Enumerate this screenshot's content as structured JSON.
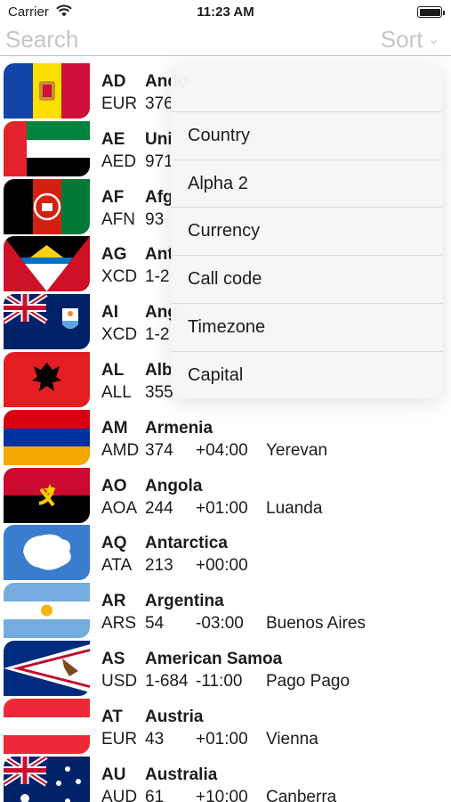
{
  "status_bar": {
    "carrier": "Carrier",
    "time": "11:23 AM"
  },
  "search": {
    "placeholder": "Search"
  },
  "sort": {
    "label": "Sort",
    "icon": "chevron-down-icon"
  },
  "sort_menu": {
    "items": [
      "Country",
      "Alpha 2",
      "Currency",
      "Call code",
      "Timezone",
      "Capital"
    ]
  },
  "countries": [
    {
      "code": "AD",
      "name": "Ando",
      "currency": "EUR",
      "call": "376",
      "tz": "",
      "capital": ""
    },
    {
      "code": "AE",
      "name": "Uni",
      "currency": "AED",
      "call": "971",
      "tz": "",
      "capital": ""
    },
    {
      "code": "AF",
      "name": "Afg",
      "currency": "AFN",
      "call": "93",
      "tz": "",
      "capital": ""
    },
    {
      "code": "AG",
      "name": "Ant",
      "currency": "XCD",
      "call": "1-2",
      "tz": "",
      "capital": ""
    },
    {
      "code": "AI",
      "name": "Ang",
      "currency": "XCD",
      "call": "1-2",
      "tz": "",
      "capital": ""
    },
    {
      "code": "AL",
      "name": "Alb",
      "currency": "ALL",
      "call": "355",
      "tz": "",
      "capital": ""
    },
    {
      "code": "AM",
      "name": "Armenia",
      "currency": "AMD",
      "call": "374",
      "tz": "+04:00",
      "capital": "Yerevan"
    },
    {
      "code": "AO",
      "name": "Angola",
      "currency": "AOA",
      "call": "244",
      "tz": "+01:00",
      "capital": "Luanda"
    },
    {
      "code": "AQ",
      "name": "Antarctica",
      "currency": "ATA",
      "call": "213",
      "tz": "+00:00",
      "capital": ""
    },
    {
      "code": "AR",
      "name": "Argentina",
      "currency": "ARS",
      "call": "54",
      "tz": "-03:00",
      "capital": "Buenos Aires"
    },
    {
      "code": "AS",
      "name": "American Samoa",
      "currency": "USD",
      "call": "1-684",
      "tz": "-11:00",
      "capital": "Pago Pago"
    },
    {
      "code": "AT",
      "name": "Austria",
      "currency": "EUR",
      "call": "43",
      "tz": "+01:00",
      "capital": "Vienna"
    },
    {
      "code": "AU",
      "name": "Australia",
      "currency": "AUD",
      "call": "61",
      "tz": "+10:00",
      "capital": "Canberra"
    }
  ]
}
